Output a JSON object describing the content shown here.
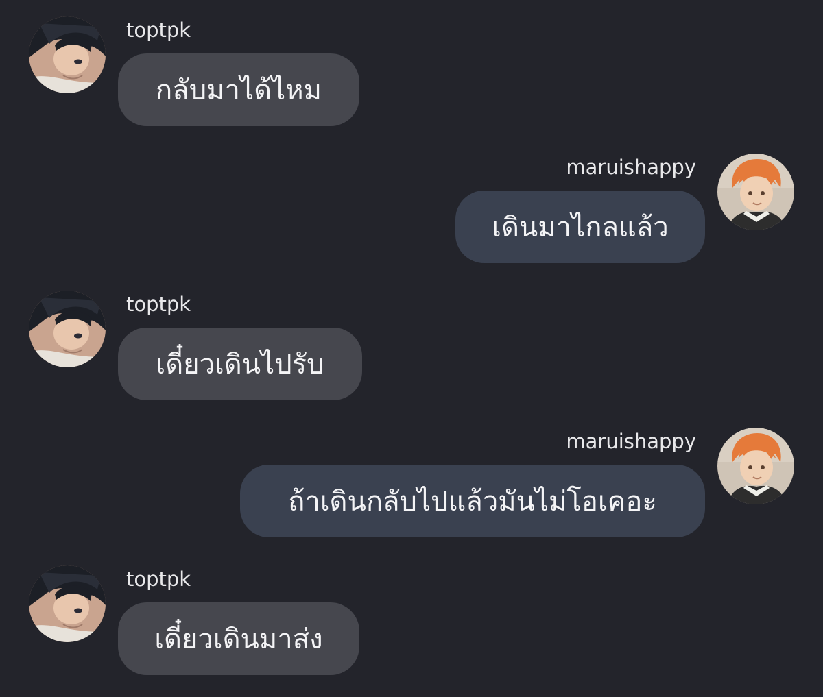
{
  "messages": [
    {
      "sender": "toptpk",
      "side": "left",
      "text": "กลับมาได้ไหม",
      "avatar_icon": "dark-haired-anime-avatar-icon"
    },
    {
      "sender": "maruishappy",
      "side": "right",
      "text": "เดินมาไกลแล้ว",
      "avatar_icon": "orange-haired-anime-avatar-icon"
    },
    {
      "sender": "toptpk",
      "side": "left",
      "text": "เดี๋ยวเดินไปรับ",
      "avatar_icon": "dark-haired-anime-avatar-icon"
    },
    {
      "sender": "maruishappy",
      "side": "right",
      "text": "ถ้าเดินกลับไปแล้วมันไม่โอเคอะ",
      "avatar_icon": "orange-haired-anime-avatar-icon"
    },
    {
      "sender": "toptpk",
      "side": "left",
      "text": "เดี๋ยวเดินมาส่ง",
      "avatar_icon": "dark-haired-anime-avatar-icon"
    }
  ],
  "colors": {
    "background": "#23242b",
    "left_bubble": "#46474e",
    "right_bubble": "#3a4150",
    "text": "#f4f4f6"
  }
}
